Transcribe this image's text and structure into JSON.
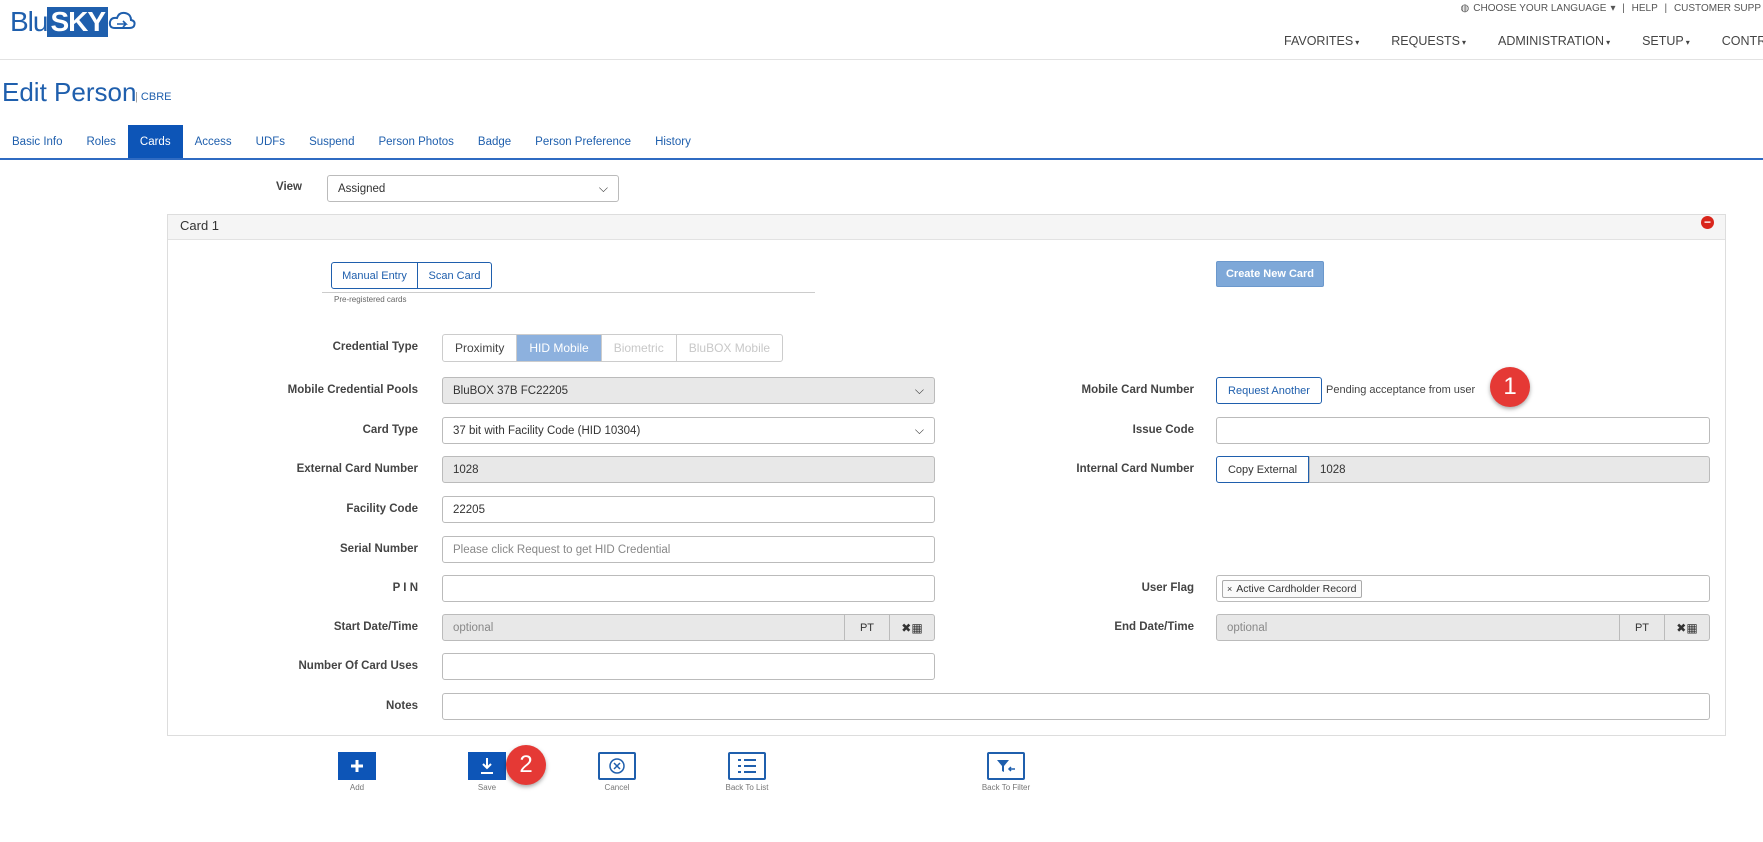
{
  "header": {
    "logo_blu": "Blu",
    "logo_sky": "SKY",
    "top_links": [
      "CHOOSE YOUR LANGUAGE",
      "HELP",
      "CUSTOMER SUPP"
    ],
    "nav": [
      "FAVORITES",
      "REQUESTS",
      "ADMINISTRATION",
      "SETUP",
      "CONTRO"
    ]
  },
  "page": {
    "title": "Edit Person",
    "subtitle": "CBRE"
  },
  "tabs": [
    "Basic Info",
    "Roles",
    "Cards",
    "Access",
    "UDFs",
    "Suspend",
    "Person Photos",
    "Badge",
    "Person Preference",
    "History"
  ],
  "active_tab": "Cards",
  "view": {
    "label": "View",
    "value": "Assigned"
  },
  "card": {
    "title": "Card 1",
    "entry_buttons": [
      "Manual Entry",
      "Scan Card"
    ],
    "preregistered": "Pre-registered cards",
    "create_new": "Create New Card",
    "credential_type": {
      "label": "Credential Type",
      "options": [
        "Proximity",
        "HID Mobile",
        "Biometric",
        "BluBOX Mobile"
      ],
      "selected": "HID Mobile"
    },
    "mobile_pools": {
      "label": "Mobile Credential Pools",
      "value": "BluBOX 37B FC22205"
    },
    "card_type": {
      "label": "Card Type",
      "value": "37 bit with Facility Code (HID 10304)"
    },
    "external_card_number": {
      "label": "External Card Number",
      "value": "1028"
    },
    "facility_code": {
      "label": "Facility Code",
      "value": "22205"
    },
    "serial_number": {
      "label": "Serial Number",
      "placeholder": "Please click Request to get HID Credential"
    },
    "pin": {
      "label": "P I N",
      "value": ""
    },
    "start_datetime": {
      "label": "Start Date/Time",
      "placeholder": "optional",
      "tz": "PT"
    },
    "num_card_uses": {
      "label": "Number Of Card Uses",
      "value": ""
    },
    "notes": {
      "label": "Notes",
      "value": ""
    },
    "mobile_card_number": {
      "label": "Mobile Card Number",
      "button": "Request Another",
      "status": "Pending acceptance from user"
    },
    "issue_code": {
      "label": "Issue Code",
      "value": ""
    },
    "internal_card_number": {
      "label": "Internal Card Number",
      "button": "Copy External",
      "value": "1028"
    },
    "user_flag": {
      "label": "User Flag",
      "tag": "Active Cardholder Record"
    },
    "end_datetime": {
      "label": "End Date/Time",
      "placeholder": "optional",
      "tz": "PT"
    }
  },
  "callouts": [
    "1",
    "2"
  ],
  "toolbar": {
    "add": "Add",
    "save": "Save",
    "cancel": "Cancel",
    "back_to_list": "Back To List",
    "back_to_filter": "Back To Filter"
  }
}
